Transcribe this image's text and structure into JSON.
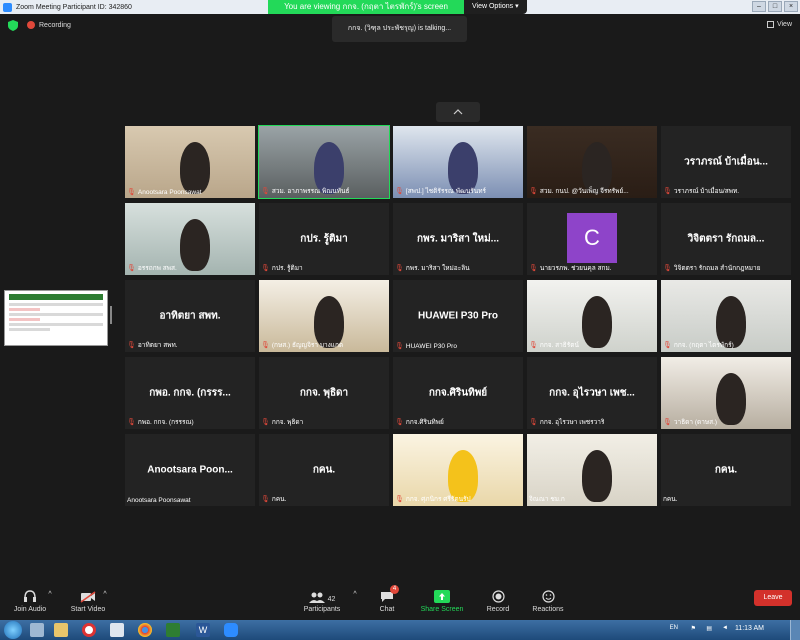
{
  "window": {
    "title": "Zoom Meeting Participant ID: 342860"
  },
  "banner": {
    "viewing": "You are viewing กกจ. (กฤตา ไตรพักร์)'s screen",
    "options": "View Options"
  },
  "top": {
    "recording": "Recording",
    "talking": "กกจ. (วิฑุล ประพัชรุญ) is talking...",
    "view": "View"
  },
  "tiles": [
    {
      "name": "Anootsara Poonsawat",
      "big": "",
      "mic_muted": true,
      "kind": "video"
    },
    {
      "name": "สวม. อาภาพรรณ พิณนทันธ์",
      "big": "",
      "mic_muted": true,
      "kind": "video"
    },
    {
      "name": "[สพป.] ไชติรัรรณ พัฒนรันทร์",
      "big": "",
      "mic_muted": true,
      "kind": "video"
    },
    {
      "name": "สวม. กนป. @วันเพ็ญ จีรทรัพย์...",
      "big": "",
      "mic_muted": true,
      "kind": "video"
    },
    {
      "name": "วราภรณ์ บ้าเมื่อน/สพท.",
      "big": "วราภรณ์ บ้าเมื่อน...",
      "mic_muted": true,
      "kind": "name"
    },
    {
      "name": "อรรถกพ สพส.",
      "big": "",
      "mic_muted": true,
      "kind": "video"
    },
    {
      "name": "กปร. รู้ติมา",
      "big": "กปร. รู้ติมา",
      "mic_muted": true,
      "kind": "name"
    },
    {
      "name": "กพร. มาริสา ใหม่อะลิน",
      "big": "กพร. มาริสา ใหม่...",
      "mic_muted": true,
      "kind": "name"
    },
    {
      "name": "นายวรภพ. ช่วยนคุล สกม.",
      "big": "C",
      "mic_muted": true,
      "kind": "avatar"
    },
    {
      "name": "วิจิตตรา รักถมล สำนักกฎหมาย",
      "big": "วิจิตตรา รักถมล...",
      "mic_muted": true,
      "kind": "name"
    },
    {
      "name": "อาทิตยา สพท.",
      "big": "อาทิตยา สพท.",
      "mic_muted": true,
      "kind": "name"
    },
    {
      "name": "(กษส.) ธัญญจิรา บางแกต",
      "big": "",
      "mic_muted": true,
      "kind": "video"
    },
    {
      "name": "HUAWEI P30 Pro",
      "big": "HUAWEI P30 Pro",
      "mic_muted": true,
      "kind": "name"
    },
    {
      "name": "กกจ. สาธิรัตน์",
      "big": "",
      "mic_muted": true,
      "kind": "video"
    },
    {
      "name": "กกจ. (กฤตา ไตรพักร์)",
      "big": "",
      "mic_muted": true,
      "kind": "video"
    },
    {
      "name": "กพอ. กกจ. (กรรรณ)",
      "big": "กพอ. กกจ. (กรรร...",
      "mic_muted": true,
      "kind": "name"
    },
    {
      "name": "กกจ. พุธิดา",
      "big": "กกจ. พุธิดา",
      "mic_muted": true,
      "kind": "name"
    },
    {
      "name": "กกจ.ศิรินทิพย์",
      "big": "กกจ.ศิรินทิพย์",
      "mic_muted": true,
      "kind": "name"
    },
    {
      "name": "กกจ. อุไรวษา เพชรวาริ",
      "big": "กกจ. อุไรวษา เพช...",
      "mic_muted": true,
      "kind": "name"
    },
    {
      "name": "วาธิดา (ดาษส.)",
      "big": "",
      "mic_muted": true,
      "kind": "video"
    },
    {
      "name": "Anootsara Poonsawat",
      "big": "Anootsara Poon...",
      "mic_muted": false,
      "kind": "name"
    },
    {
      "name": "กคน.",
      "big": "กคน.",
      "mic_muted": true,
      "kind": "name"
    },
    {
      "name": "กกจ. ศุภนิกร ศรีรัตนรัป",
      "big": "",
      "mic_muted": true,
      "kind": "video"
    },
    {
      "name": "จิณณา ชม.ก",
      "big": "",
      "mic_muted": false,
      "kind": "video"
    },
    {
      "name": "กคน.",
      "big": "กคน.",
      "mic_muted": false,
      "kind": "name"
    }
  ],
  "toolbar": {
    "join_audio": "Join Audio",
    "start_video": "Start Video",
    "participants": "Participants",
    "participants_count": "42",
    "chat": "Chat",
    "chat_badge": "4",
    "share_screen": "Share Screen",
    "record": "Record",
    "reactions": "Reactions",
    "leave": "Leave"
  },
  "taskbar": {
    "time": "11:13 AM",
    "lang": "EN"
  }
}
